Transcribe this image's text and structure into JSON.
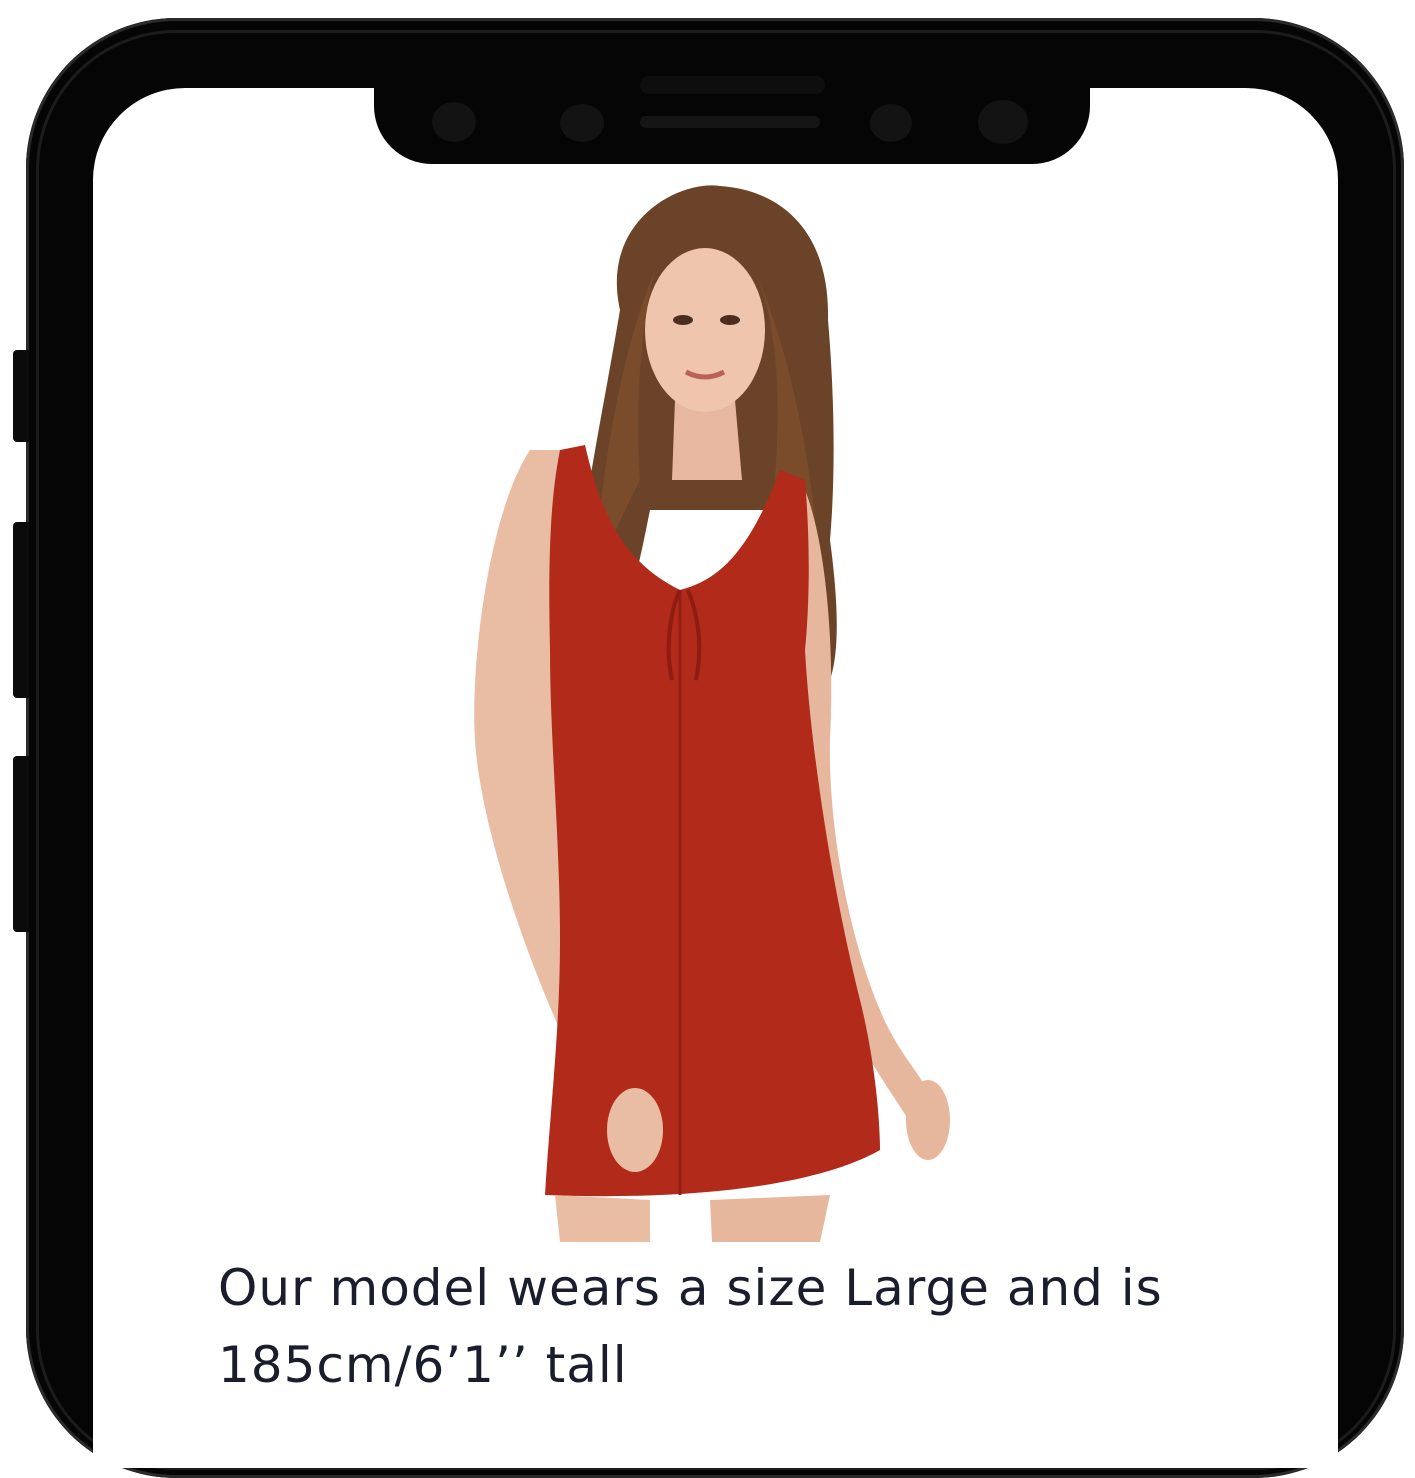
{
  "product": {
    "model_note": "Our model wears a size Large and is 185cm/6’1’’ tall",
    "dress_color": "#b22a1a",
    "hair_color": "#6b4328"
  },
  "device": {
    "frame_color": "#050505",
    "screen_color": "#ffffff"
  },
  "icons": {
    "front_camera": "camera-icon",
    "speaker": "speaker-grille"
  }
}
